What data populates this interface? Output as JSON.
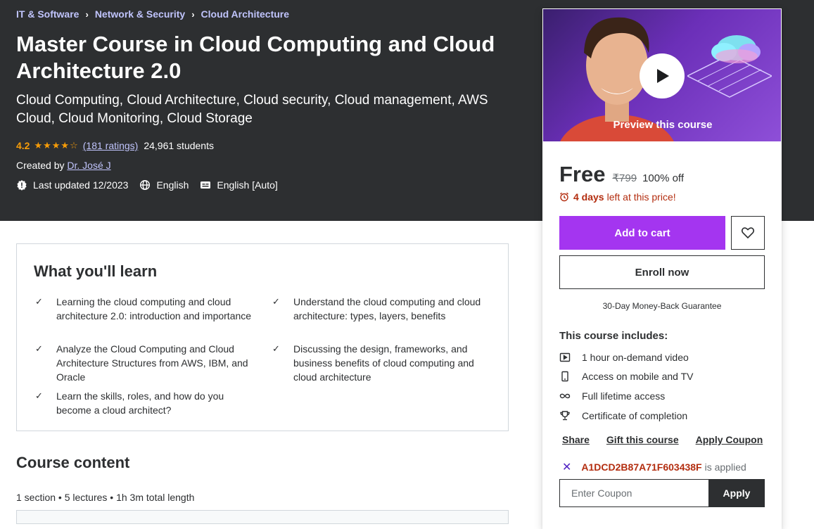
{
  "breadcrumb": [
    "IT & Software",
    "Network & Security",
    "Cloud Architecture"
  ],
  "course": {
    "title": "Master Course in Cloud Computing and Cloud Architecture 2.0",
    "subtitle": "Cloud Computing, Cloud Architecture, Cloud security, Cloud management, AWS Cloud, Cloud Monitoring, Cloud Storage",
    "rating": "4.2",
    "ratings_count": "(181 ratings)",
    "students": "24,961 students",
    "created_by_label": "Created by",
    "instructor": "Dr. José J",
    "last_updated": "Last updated 12/2023",
    "language": "English",
    "captions": "English [Auto]"
  },
  "learn": {
    "title": "What you'll learn",
    "items": [
      "Learning the cloud computing and cloud architecture 2.0: introduction and importance",
      "Understand the cloud computing and cloud architecture: types, layers, benefits",
      "Analyze the Cloud Computing and Cloud Architecture Structures from AWS, IBM, and Oracle",
      "Discussing the design, frameworks, and business benefits of cloud computing and cloud architecture",
      "Learn the skills, roles, and how do you become a cloud architect?"
    ]
  },
  "content": {
    "title": "Course content",
    "meta": "1 section • 5 lectures • 1h 3m total length"
  },
  "sidebar": {
    "preview_label": "Preview this course",
    "price": "Free",
    "original_price": "₹799",
    "discount": "100% off",
    "timer_bold": "4 days",
    "timer_rest": "left at this price!",
    "add_to_cart": "Add to cart",
    "enroll_now": "Enroll now",
    "guarantee": "30-Day Money-Back Guarantee",
    "includes_title": "This course includes:",
    "includes": [
      {
        "icon": "video-icon",
        "label": "1 hour on-demand video"
      },
      {
        "icon": "mobile-icon",
        "label": "Access on mobile and TV"
      },
      {
        "icon": "infinity-icon",
        "label": "Full lifetime access"
      },
      {
        "icon": "trophy-icon",
        "label": "Certificate of completion"
      }
    ],
    "share": "Share",
    "gift": "Gift this course",
    "apply_coupon": "Apply Coupon",
    "coupon_code": "A1DCD2B87A71F603438F",
    "coupon_status": "is applied",
    "coupon_placeholder": "Enter Coupon",
    "coupon_apply": "Apply"
  },
  "colors": {
    "hero_bg": "#2d2f31",
    "accent": "#a435f0",
    "link": "#c0c4fc",
    "star": "#f69c08",
    "alert": "#b32d0f"
  }
}
